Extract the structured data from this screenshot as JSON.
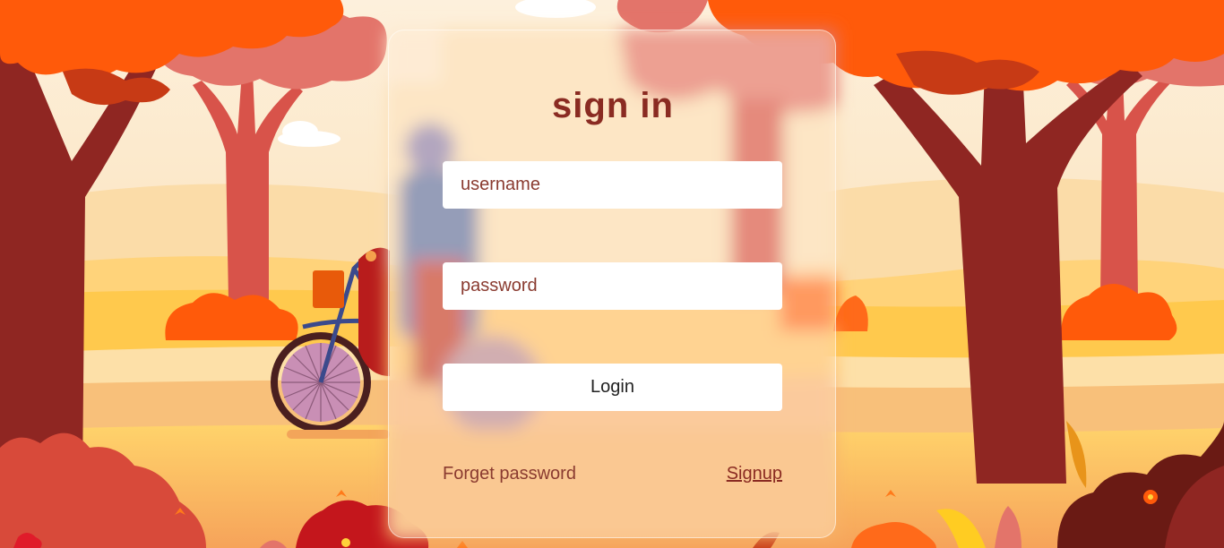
{
  "login_form": {
    "title": "sign in",
    "username_placeholder": "username",
    "password_placeholder": "password",
    "login_label": "Login",
    "forget_password_label": "Forget password",
    "signup_label": "Signup"
  },
  "colors": {
    "sky": "#fdebd0",
    "foliage": "#ff5a0a",
    "trunk": "#8f2622",
    "pink_tree": "#d8534a",
    "field_yellow": "#ffc94d",
    "title": "#8a2b22"
  }
}
